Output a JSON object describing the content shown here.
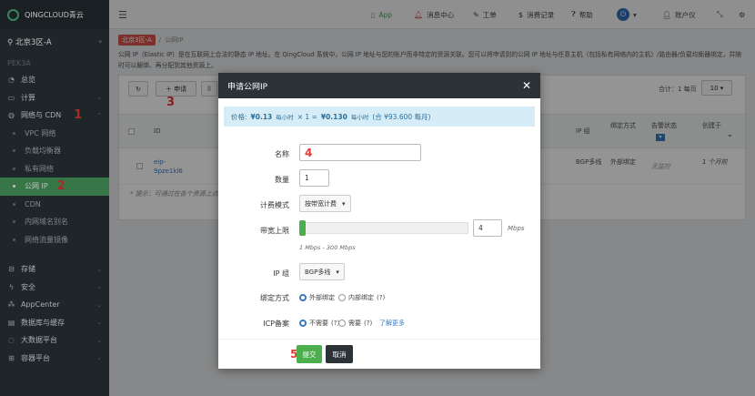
{
  "sidebar": {
    "logo": "QINGCLOUD青云",
    "region": "北京3区-A",
    "zone": "PEK3A",
    "items": [
      {
        "label": "总览",
        "icon": "dashboard-icon"
      },
      {
        "label": "计算",
        "icon": "monitor-icon"
      },
      {
        "label": "网络与 CDN",
        "icon": "globe-icon"
      },
      {
        "label": "存储",
        "icon": "storage-icon"
      },
      {
        "label": "安全",
        "icon": "lightning-icon"
      },
      {
        "label": "AppCenter",
        "icon": "apps-icon"
      },
      {
        "label": "数据库与缓存",
        "icon": "database-icon"
      },
      {
        "label": "大数据平台",
        "icon": "bigdata-icon"
      },
      {
        "label": "容器平台",
        "icon": "container-icon"
      }
    ],
    "network_sub": [
      "VPC 网络",
      "负载均衡器",
      "私有网络",
      "公网 IP",
      "CDN",
      "内网域名别名",
      "网络流量镜像"
    ]
  },
  "topbar": {
    "app": "App",
    "messages": "消息中心",
    "tickets": "工单",
    "billing": "消费记录",
    "help": "帮助",
    "account": "账户仪"
  },
  "content": {
    "crumb_region": "北京3区-A",
    "crumb_page": "公网IP",
    "info": "公网 IP（Elastic IP）是在互联网上合法的静态 IP 地址。在 QingCloud 系统中，公网 IP 地址与您的账户而非特定的资源关联。您可以将申请到的公网 IP 地址与任意主机（包括私有网络内的主机）/路由器/负载均衡器绑定，并随时可以解绑、再分配到其他资源上。",
    "apply_label": "申请",
    "total": "合计：1 每页",
    "per_page": "10",
    "columns": [
      "ID",
      "IP 组",
      "绑定方式",
      "告警状态",
      "创建于"
    ],
    "row": {
      "id": "eip-9pze1kl6",
      "ip_group": "BGP多线",
      "bind": "外部绑定",
      "alarm": "无监控",
      "created": "1 个月前"
    },
    "tip": "* 提示：可通过在各个资源上点"
  },
  "modal": {
    "title": "申请公网IP",
    "price_label": "价格:",
    "price_unit": "¥0.13",
    "price_unit_suffix": "每小时",
    "price_count": "× 1 =",
    "price_total": "¥0.130",
    "price_total_suffix": "每小时",
    "price_month": "(合 ¥93.600 每月)",
    "name_label": "名称",
    "count_label": "数量",
    "count_value": "1",
    "billing_label": "计费模式",
    "billing_value": "按带宽计费",
    "bandwidth_label": "带宽上限",
    "bandwidth_value": "4",
    "bandwidth_unit": "Mbps",
    "bandwidth_range": "1 Mbps - 300 Mbps",
    "ipgroup_label": "IP 组",
    "ipgroup_value": "BGP多线",
    "bindmode_label": "绑定方式",
    "bind_external": "外部绑定",
    "bind_internal": "内部绑定",
    "icp_label": "ICP备案",
    "icp_no": "不需要",
    "icp_yes": "需要",
    "icp_more": "了解更多",
    "help_mark": "(?)",
    "submit": "提交",
    "cancel": "取消"
  },
  "annotations": [
    "1",
    "2",
    "3",
    "4",
    "5"
  ],
  "colors": {
    "sidebar_bg": "#2a3338",
    "active_green": "#4a9f5f",
    "modal_header": "#2b3338",
    "annotation_red": "#e53935",
    "price_bg": "#d6edf7"
  }
}
